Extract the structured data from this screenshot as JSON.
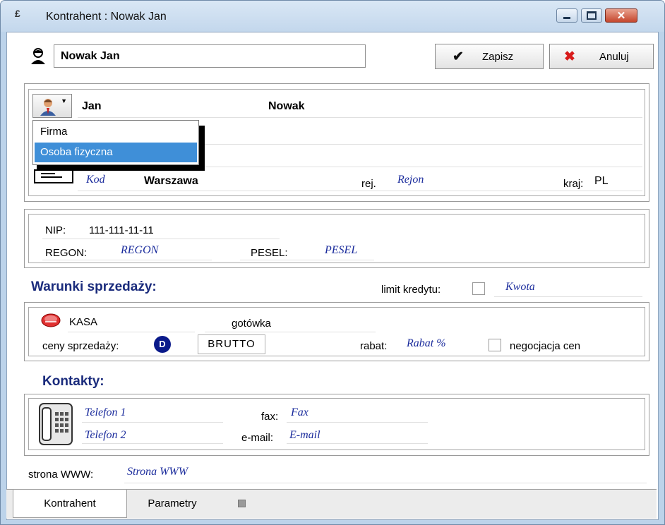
{
  "window": {
    "app_icon": "£",
    "title": "Kontrahent : Nowak Jan",
    "min_icon": "minimize-icon",
    "max_icon": "maximize-icon",
    "close_glyph": "✕"
  },
  "header": {
    "name_value": "Nowak Jan",
    "save_check": "✔",
    "save_label": "Zapisz",
    "cancel_x": "✖",
    "cancel_label": "Anuluj"
  },
  "address": {
    "first_name": "Jan",
    "last_name": "Nowak",
    "kod_placeholder": "Kod",
    "city": "Warszawa",
    "rej_label": "rej.",
    "region_placeholder": "Rejon",
    "kraj_label": "kraj:",
    "kraj_value": "PL"
  },
  "type_menu": {
    "items": [
      "Firma",
      "Osoba fizyczna"
    ],
    "selected_index": 1
  },
  "ids": {
    "nip_label": "NIP:",
    "nip_value": "111-111-11-11",
    "regon_label": "REGON:",
    "regon_placeholder": "REGON",
    "pesel_label": "PESEL:",
    "pesel_placeholder": "PESEL"
  },
  "sales": {
    "title": "Warunki sprzedaży:",
    "credit_limit_label": "limit kredytu:",
    "amount_placeholder": "Kwota",
    "payment_method": "KASA",
    "payment_type": "gotówka",
    "prices_label": "ceny sprzedaży:",
    "price_mode_badge": "D",
    "price_mode": "BRUTTO",
    "discount_label": "rabat:",
    "discount_placeholder": "Rabat %",
    "negotiation_label": "negocjacja cen"
  },
  "contacts": {
    "title": "Kontakty:",
    "phone1_placeholder": "Telefon 1",
    "phone2_placeholder": "Telefon 2",
    "fax_label": "fax:",
    "fax_placeholder": "Fax",
    "email_label": "e-mail:",
    "email_placeholder": "E-mail",
    "www_label": "strona WWW:",
    "www_placeholder": "Strona WWW"
  },
  "tabs": {
    "active": "Kontrahent",
    "inactive": "Parametry"
  }
}
